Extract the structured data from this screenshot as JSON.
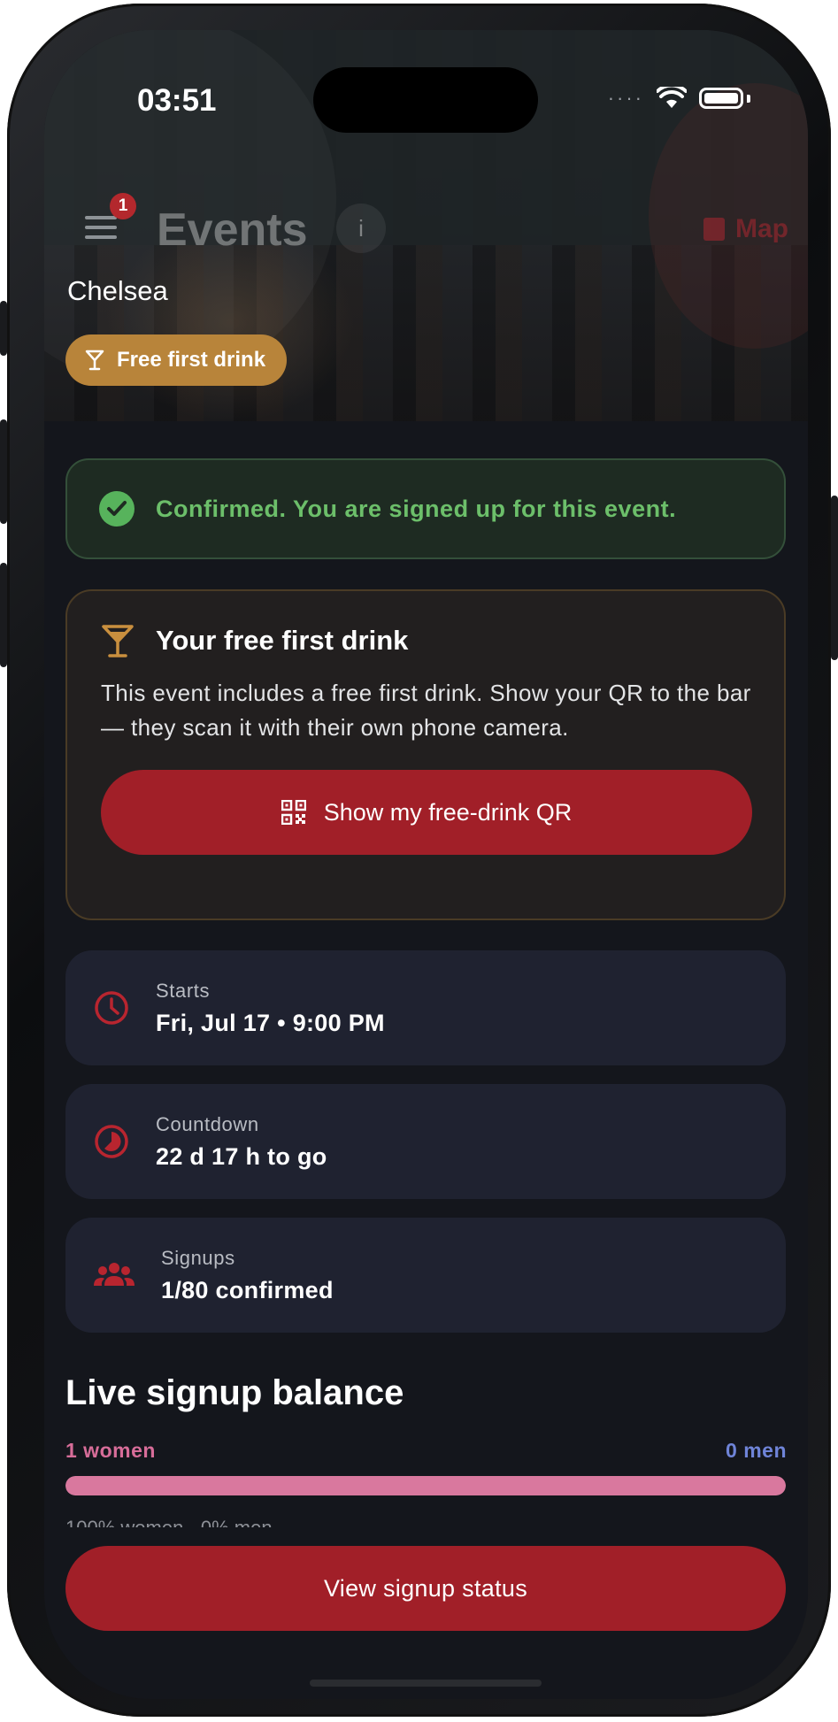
{
  "status_bar": {
    "time": "03:51",
    "signal": "····"
  },
  "app_bar": {
    "title": "Events",
    "badge_count": "1",
    "info_label": "i",
    "map_label": "Map"
  },
  "hero": {
    "venue": "Chelsea",
    "chip_label": "Free first drink"
  },
  "confirmation": {
    "text": "Confirmed. You are signed up for this event."
  },
  "drink_card": {
    "title": "Your free first drink",
    "body": "This event includes a free first drink. Show your QR to the bar — they scan it with their own phone camera.",
    "button_label": "Show my free-drink QR"
  },
  "details": {
    "starts": {
      "label": "Starts",
      "value": "Fri, Jul 17 • 9:00 PM"
    },
    "countdown": {
      "label": "Countdown",
      "value": "22 d 17 h to go"
    },
    "signups": {
      "label": "Signups",
      "value": "1/80 confirmed"
    }
  },
  "balance": {
    "title": "Live signup balance",
    "women_label": "1 women",
    "men_label": "0 men",
    "women_share": 1.0,
    "summary": "100% women · 0% men"
  },
  "footer": {
    "button_label": "View signup status"
  },
  "colors": {
    "accent_red": "#a11f28",
    "success_green": "#6cbf6a",
    "gold": "#b8843a",
    "women_pink": "#d9789e",
    "men_blue": "#6f84d8"
  }
}
